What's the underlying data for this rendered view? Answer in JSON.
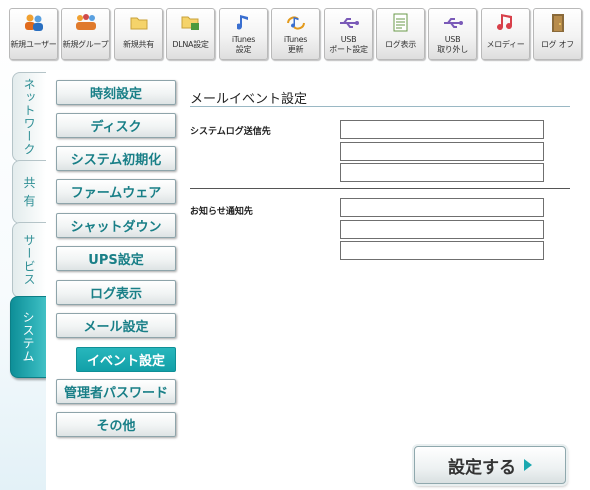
{
  "toolbar": {
    "items": [
      {
        "label": "新規ユーザー",
        "icon": "users-icon"
      },
      {
        "label": "新規グループ",
        "icon": "group-icon"
      },
      {
        "label": "新規共有",
        "icon": "folder-icon"
      },
      {
        "label": "DLNA設定",
        "icon": "dlna-folder-icon"
      },
      {
        "label": "iTunes\n設定",
        "icon": "music-note-icon"
      },
      {
        "label": "iTunes\n更新",
        "icon": "music-update-icon"
      },
      {
        "label": "USB\nポート設定",
        "icon": "usb-icon"
      },
      {
        "label": "ログ表示",
        "icon": "document-icon"
      },
      {
        "label": "USB\n取り外し",
        "icon": "usb-eject-icon"
      },
      {
        "label": "メロディー",
        "icon": "melody-icon"
      },
      {
        "label": "ログ オフ",
        "icon": "logoff-door-icon"
      }
    ]
  },
  "tabs": [
    {
      "label": "ネットワーク",
      "active": false
    },
    {
      "label": "共 有",
      "active": false
    },
    {
      "label": "サービス",
      "active": false
    },
    {
      "label": "システム",
      "active": true
    }
  ],
  "menu": {
    "items": [
      {
        "label": "時刻設定"
      },
      {
        "label": "ディスク"
      },
      {
        "label": "システム初期化"
      },
      {
        "label": "ファームウェア"
      },
      {
        "label": "シャットダウン"
      },
      {
        "label": "UPS設定"
      },
      {
        "label": "ログ表示"
      },
      {
        "label": "メール設定"
      },
      {
        "label": "イベント設定",
        "active": true
      },
      {
        "label": "管理者パスワード"
      },
      {
        "label": "その他"
      }
    ]
  },
  "content": {
    "title": "メールイベント設定",
    "syslog_label": "システムログ送信先",
    "syslog_fields": [
      "",
      "",
      ""
    ],
    "notify_label": "お知らせ通知先",
    "notify_fields": [
      "",
      "",
      ""
    ],
    "submit_label": "設定する"
  },
  "colors": {
    "accent": "#1aa8b0",
    "accent_text": "#197f87"
  }
}
